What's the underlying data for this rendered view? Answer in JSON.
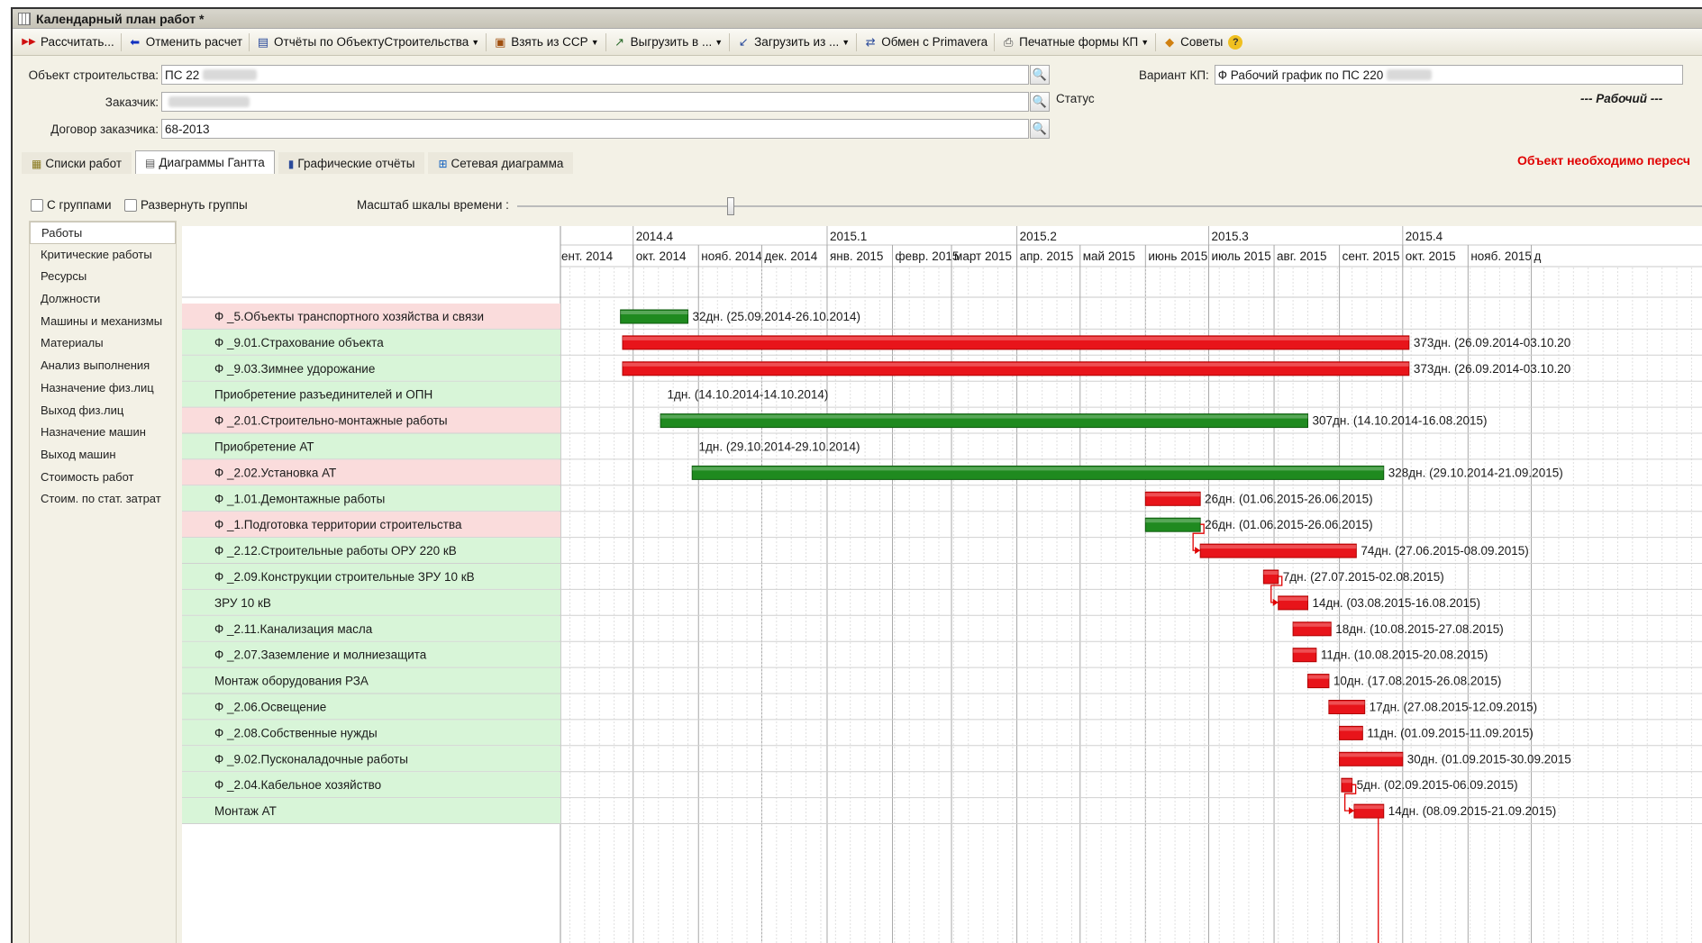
{
  "window": {
    "title": "Календарный план работ *"
  },
  "toolbar": [
    {
      "label": "Рассчитать...",
      "icon": "run-icon",
      "dropdown": false
    },
    {
      "label": "Отменить расчет",
      "icon": "back-arrow-icon",
      "dropdown": false
    },
    {
      "label": "Отчёты по ОбъектуСтроительства",
      "icon": "report-icon",
      "dropdown": true
    },
    {
      "label": "Взять из ССР",
      "icon": "take-icon",
      "dropdown": true
    },
    {
      "label": "Выгрузить в ...",
      "icon": "export-icon",
      "dropdown": true
    },
    {
      "label": "Загрузить из ...",
      "icon": "import-icon",
      "dropdown": true
    },
    {
      "label": "Обмен с Primavera",
      "icon": "exchange-icon",
      "dropdown": false
    },
    {
      "label": "Печатные формы КП",
      "icon": "print-icon",
      "dropdown": true
    },
    {
      "label": "Советы",
      "icon": "tips-icon",
      "dropdown": false
    }
  ],
  "form": {
    "object_label": "Объект строительства:",
    "object_value": "ПС 22",
    "customer_label": "Заказчик:",
    "customer_value": "",
    "contract_label": "Договор заказчика:",
    "contract_value": "68-2013",
    "variant_label": "Вариант КП:",
    "variant_value": "Ф Рабочий  график по ПС 220",
    "status_label": "Статус",
    "status_value": "--- Рабочий ---"
  },
  "tabs": [
    {
      "label": "Списки работ",
      "icon": "list-icon",
      "active": false
    },
    {
      "label": "Диаграммы Гантта",
      "icon": "gantt-icon",
      "active": true
    },
    {
      "label": "Графические отчёты",
      "icon": "chart-icon",
      "active": false
    },
    {
      "label": "Сетевая диаграмма",
      "icon": "network-icon",
      "active": false
    }
  ],
  "warning": "Объект необходимо пересч",
  "options": {
    "groups_label": "С группами",
    "expand_label": "Развернуть группы",
    "scale_label": "Масштаб шкалы времени :"
  },
  "nav": [
    "Работы",
    "Критические работы",
    "Ресурсы",
    "Должности",
    "Машины и механизмы",
    "Материалы",
    "Анализ выполнения",
    "Назначение физ.лиц",
    "Выход физ.лиц",
    "Назначение машин",
    "Выход машин",
    "Стоимость работ",
    "Стоим. по стат. затрат"
  ],
  "colors": {
    "red_bar": "#e8141a",
    "green_bar": "#1f8a1f",
    "row_pink": "#fadcdc",
    "row_green": "#d8f5d8",
    "link": "#e00000"
  },
  "timeline": {
    "quarters": [
      "2014.4",
      "2015.1",
      "2015.2",
      "2015.3",
      "2015.4"
    ],
    "months": [
      "ент. 2014",
      "окт. 2014",
      "нояб. 2014",
      "дек. 2014",
      "янв. 2015",
      "февр. 2015",
      "март 2015",
      "апр. 2015",
      "май 2015",
      "июнь 2015",
      "июль 2015",
      "авг. 2015",
      "сент. 2015",
      "окт. 2015",
      "нояб. 2015",
      "д"
    ]
  },
  "tasks": [
    {
      "name": "Ф _5.Объекты транспортного хозяйства и связи",
      "row": "pink",
      "color": "green",
      "start": "2014-09-25",
      "end": "2014-10-26",
      "label": "32дн. (25.09.2014-26.10.2014)"
    },
    {
      "name": "Ф _9.01.Страхование объекта",
      "row": "green",
      "color": "red",
      "start": "2014-09-26",
      "end": "2015-10-03",
      "label": "373дн. (26.09.2014-03.10.20"
    },
    {
      "name": "Ф _9.03.Зимнее удорожание",
      "row": "green",
      "color": "red",
      "start": "2014-09-26",
      "end": "2015-10-03",
      "label": "373дн. (26.09.2014-03.10.20"
    },
    {
      "name": "Приобретение разъединителей и ОПН",
      "row": "green",
      "color": "none",
      "start": "2014-10-14",
      "end": "2014-10-14",
      "label": "1дн. (14.10.2014-14.10.2014)"
    },
    {
      "name": "Ф _2.01.Строительно-монтажные работы",
      "row": "pink",
      "color": "green",
      "start": "2014-10-14",
      "end": "2015-08-16",
      "label": "307дн. (14.10.2014-16.08.2015)"
    },
    {
      "name": "Приобретение АТ",
      "row": "green",
      "color": "none",
      "start": "2014-10-29",
      "end": "2014-10-29",
      "label": "1дн. (29.10.2014-29.10.2014)"
    },
    {
      "name": "Ф _2.02.Установка АТ",
      "row": "pink",
      "color": "green",
      "start": "2014-10-29",
      "end": "2015-09-21",
      "label": "328дн. (29.10.2014-21.09.2015)"
    },
    {
      "name": "Ф _1.01.Демонтажные работы",
      "row": "green",
      "color": "red",
      "start": "2015-06-01",
      "end": "2015-06-26",
      "label": "26дн. (01.06.2015-26.06.2015)"
    },
    {
      "name": "Ф _1.Подготовка территории строительства",
      "row": "pink",
      "color": "green",
      "start": "2015-06-01",
      "end": "2015-06-26",
      "label": "26дн. (01.06.2015-26.06.2015)"
    },
    {
      "name": "Ф _2.12.Строительные работы ОРУ 220 кВ",
      "row": "green",
      "color": "red",
      "start": "2015-06-27",
      "end": "2015-09-08",
      "label": "74дн. (27.06.2015-08.09.2015)"
    },
    {
      "name": "Ф _2.09.Конструкции строительные ЗРУ 10 кВ",
      "row": "green",
      "color": "red",
      "start": "2015-07-27",
      "end": "2015-08-02",
      "label": "7дн. (27.07.2015-02.08.2015)"
    },
    {
      "name": "ЗРУ 10 кВ",
      "row": "green",
      "color": "red",
      "start": "2015-08-03",
      "end": "2015-08-16",
      "label": "14дн. (03.08.2015-16.08.2015)"
    },
    {
      "name": "Ф _2.11.Канализация масла",
      "row": "green",
      "color": "red",
      "start": "2015-08-10",
      "end": "2015-08-27",
      "label": "18дн. (10.08.2015-27.08.2015)"
    },
    {
      "name": "Ф _2.07.Заземление и молниезащита",
      "row": "green",
      "color": "red",
      "start": "2015-08-10",
      "end": "2015-08-20",
      "label": "11дн. (10.08.2015-20.08.2015)"
    },
    {
      "name": "Монтаж оборудования РЗА",
      "row": "green",
      "color": "red",
      "start": "2015-08-17",
      "end": "2015-08-26",
      "label": "10дн. (17.08.2015-26.08.2015)"
    },
    {
      "name": "Ф _2.06.Освещение",
      "row": "green",
      "color": "red",
      "start": "2015-08-27",
      "end": "2015-09-12",
      "label": "17дн. (27.08.2015-12.09.2015)"
    },
    {
      "name": "Ф _2.08.Собственные нужды",
      "row": "green",
      "color": "red",
      "start": "2015-09-01",
      "end": "2015-09-11",
      "label": "11дн. (01.09.2015-11.09.2015)"
    },
    {
      "name": "Ф _9.02.Пусконаладочные работы",
      "row": "green",
      "color": "red",
      "start": "2015-09-01",
      "end": "2015-09-30",
      "label": "30дн. (01.09.2015-30.09.2015"
    },
    {
      "name": "Ф _2.04.Кабельное хозяйство",
      "row": "green",
      "color": "red",
      "start": "2015-09-02",
      "end": "2015-09-06",
      "label": "5дн. (02.09.2015-06.09.2015)"
    },
    {
      "name": "Монтаж АТ",
      "row": "green",
      "color": "red",
      "start": "2015-09-08",
      "end": "2015-09-21",
      "label": "14дн. (08.09.2015-21.09.2015)"
    }
  ]
}
